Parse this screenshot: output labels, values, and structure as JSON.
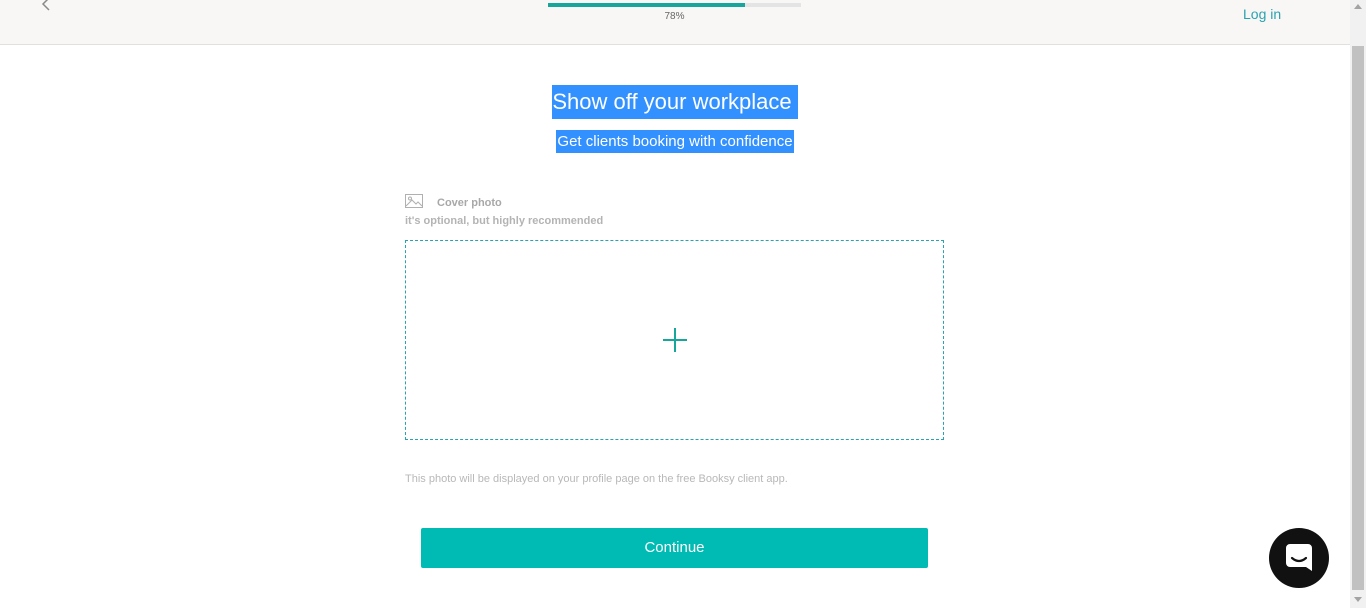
{
  "header": {
    "progress_percent": 78,
    "progress_label": "78%",
    "login_label": "Log in",
    "back_icon": "chevron-left-icon"
  },
  "main": {
    "title": "Show off your workplace",
    "subtitle": "Get clients booking with confidence",
    "cover": {
      "icon": "image-icon",
      "label": "Cover photo",
      "hint": "it's optional, but highly recommended",
      "add_icon": "plus-icon"
    },
    "footnote": "This photo will be displayed on your profile page on the free Booksy client app.",
    "continue_label": "Continue"
  },
  "chat": {
    "icon": "chat-icon"
  },
  "colors": {
    "accent": "#00bbb4",
    "link": "#2aa3b0",
    "selection": "#3390ff"
  }
}
